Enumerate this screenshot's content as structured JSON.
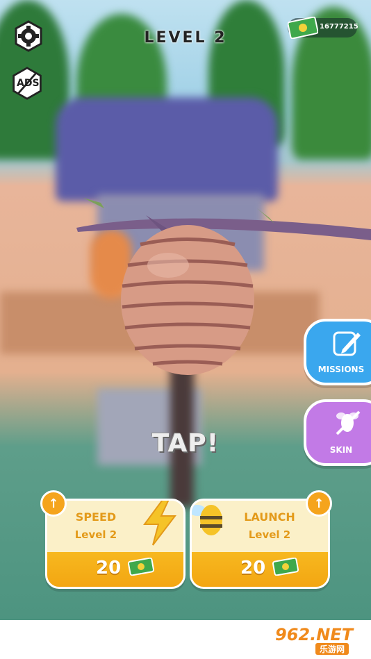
{
  "hud": {
    "level_title": "LEVEL 2",
    "money_amount": "16777215",
    "ads_label": "ADS"
  },
  "side_buttons": {
    "missions_label": "MISSIONS",
    "skin_label": "SKIN"
  },
  "prompt": {
    "tap_text": "TAP!"
  },
  "upgrades": [
    {
      "title": "SPEED",
      "level": "Level 2",
      "price": "20"
    },
    {
      "title": "LAUNCH",
      "level": "Level 2",
      "price": "20"
    }
  ],
  "watermark": {
    "brand": "962.NET",
    "subtitle": "乐游网"
  },
  "colors": {
    "missions_bg": "#3aa7ee",
    "skin_bg": "#c27ae6",
    "upgrade_accent": "#f5a41c"
  },
  "icons": [
    "gear-icon",
    "no-ads-icon",
    "cash-icon",
    "pencil-icon",
    "bee-crossed-icon",
    "up-arrow-icon",
    "lightning-icon",
    "bee-icon"
  ]
}
